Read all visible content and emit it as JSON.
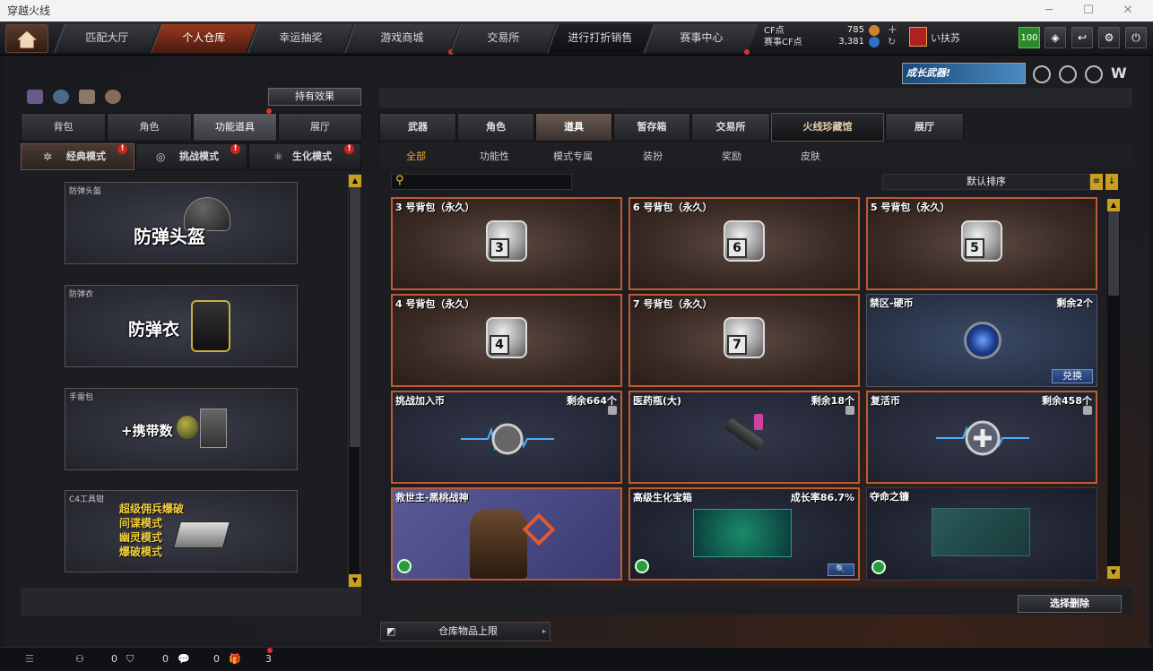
{
  "window": {
    "title": "穿越火线"
  },
  "nav": {
    "tabs": [
      "匹配大厅",
      "个人仓库",
      "幸运抽奖",
      "游戏商城",
      "交易所",
      "进行打折销售",
      "赛事中心"
    ]
  },
  "currency": {
    "cf_label": "CF点",
    "cf_value": "785",
    "event_label": "赛事CF点",
    "event_value": "3,381"
  },
  "user": {
    "name": "い扶苏",
    "level_badge": "100"
  },
  "promo": {
    "text": "成长武器!"
  },
  "left": {
    "effect_button": "持有效果",
    "tabs": [
      "背包",
      "角色",
      "功能道具",
      "展厅"
    ],
    "modes": [
      "经典模式",
      "挑战模式",
      "生化模式"
    ],
    "cards": [
      {
        "tag": "防弹头盔",
        "big": "防弹头盔"
      },
      {
        "tag": "防弹衣",
        "big": "防弹衣"
      },
      {
        "tag": "手雷包",
        "big": "+携带数"
      },
      {
        "tag": "C4工具钳",
        "lines": [
          "超级佣兵爆破",
          "间谍模式",
          "幽灵模式",
          "爆破模式"
        ]
      }
    ]
  },
  "right": {
    "tabs": [
      "武器",
      "角色",
      "道具",
      "暂存箱",
      "交易所",
      "火线珍藏馆",
      "展厅"
    ],
    "subtabs": [
      "全部",
      "功能性",
      "模式专属",
      "装扮",
      "奖励",
      "皮肤"
    ],
    "sort_label": "默认排序",
    "items": [
      {
        "name": "3 号背包（永久）",
        "num": "3"
      },
      {
        "name": "6 号背包（永久）",
        "num": "6"
      },
      {
        "name": "5 号背包（永久）",
        "num": "5"
      },
      {
        "name": "4 号背包（永久）",
        "num": "4"
      },
      {
        "name": "7 号背包（永久）",
        "num": "7"
      },
      {
        "name": "禁区-硬币",
        "remain": "剩余2个",
        "action": "兑换"
      },
      {
        "name": "挑战加入币",
        "remain": "剩余664个"
      },
      {
        "name": "医药瓶(大)",
        "remain": "剩余18个"
      },
      {
        "name": "复活币",
        "remain": "剩余458个"
      },
      {
        "name": "救世主-黑桃战神"
      },
      {
        "name": "高级生化宝箱",
        "remain": "成长率86.7%"
      },
      {
        "name": "夺命之镰"
      }
    ],
    "delete_button": "选择删除",
    "storage_label": "仓库物品上限"
  },
  "bottom": {
    "counts": [
      "0",
      "0",
      "0",
      "3"
    ]
  }
}
